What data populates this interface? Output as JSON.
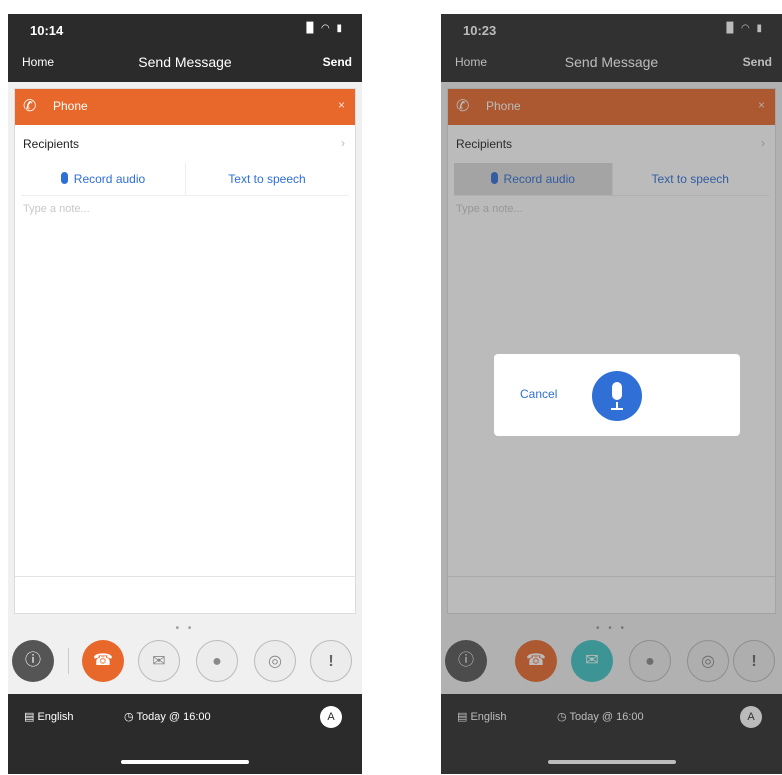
{
  "left": {
    "status_time": "10:14",
    "status_icons": "▉ ◠ ▮",
    "nav": {
      "home": "Home",
      "title": "Send Message",
      "send": "Send"
    },
    "channel": {
      "label": "Phone",
      "close": "×"
    },
    "recipients": {
      "label": "Recipients",
      "chevron": "›",
      "detail": ""
    },
    "modes": {
      "record": "Record audio",
      "tts": "Text to speech"
    },
    "message_placeholder": "Type a note...",
    "page_dots": "• •",
    "tray": {
      "info": "ⓘ",
      "phone": "☎",
      "email": "✉",
      "chat": "●",
      "web": "◎",
      "alert": "!"
    },
    "bottom": {
      "language": "English",
      "schedule": "Today @ 16:00",
      "avatar": "A"
    }
  },
  "right": {
    "status_time": "10:23",
    "status_icons": "▉ ◠ ▮",
    "nav": {
      "home": "Home",
      "title": "Send Message",
      "send": "Send"
    },
    "channel": {
      "label": "Phone",
      "close": "×"
    },
    "recipients": {
      "label": "Recipients",
      "chevron": "›",
      "detail": ""
    },
    "modes": {
      "record": "Record audio",
      "tts": "Text to speech"
    },
    "message_placeholder": "Type a note...",
    "page_dots": "• • •",
    "tray": {
      "info": "ⓘ",
      "phone": "☎",
      "email": "✉",
      "chat": "●",
      "web": "◎",
      "alert": "!"
    },
    "bottom": {
      "language": "English",
      "schedule": "Today @ 16:00",
      "avatar": "A"
    },
    "dialog": {
      "cancel": "Cancel"
    }
  },
  "colors": {
    "accent": "#e8672b",
    "link": "#2f6fd6",
    "bar": "#2b2b2b",
    "teal": "#3cc4c4"
  }
}
